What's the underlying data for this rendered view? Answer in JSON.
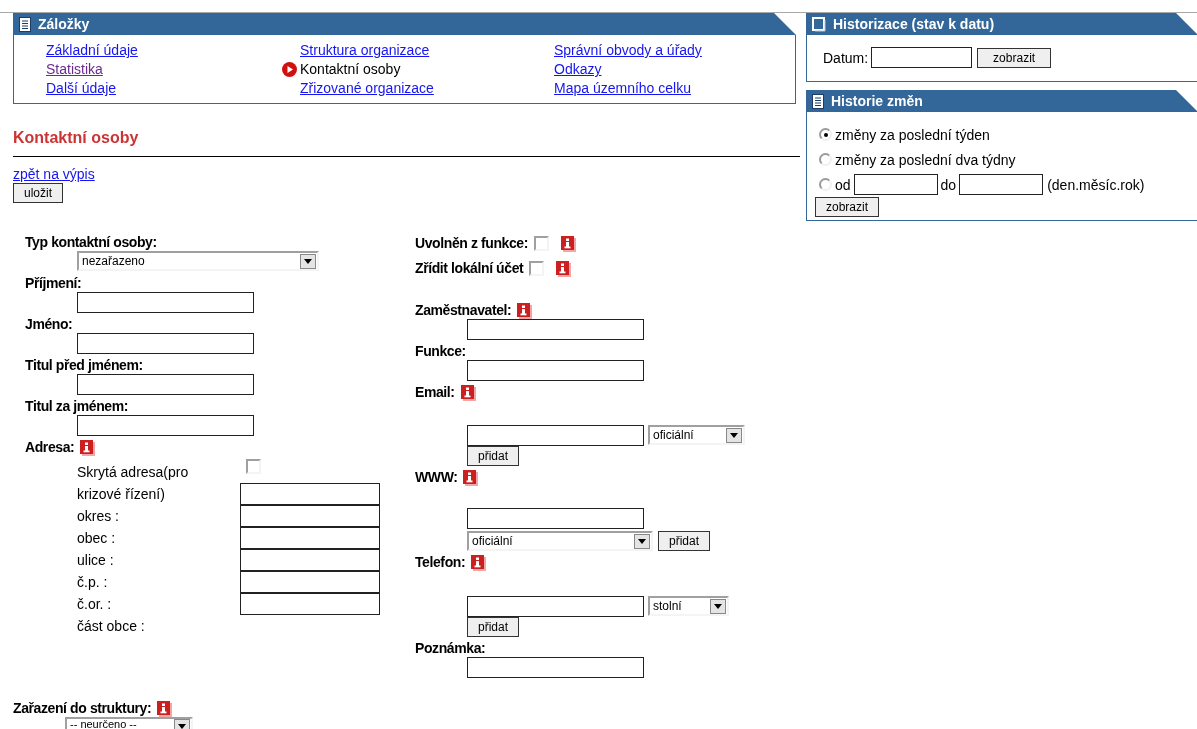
{
  "bookmarks": {
    "title": "Záložky",
    "links": [
      {
        "label": "Základní údaje",
        "selected": false,
        "visited": false
      },
      {
        "label": "Struktura organizace",
        "selected": false,
        "visited": false
      },
      {
        "label": "Správní obvody a úřady",
        "selected": false,
        "visited": false
      },
      {
        "label": "Statistika",
        "selected": false,
        "visited": true
      },
      {
        "label": "Kontaktní osoby",
        "selected": true,
        "visited": false
      },
      {
        "label": "Odkazy",
        "selected": false,
        "visited": false
      },
      {
        "label": "Další údaje",
        "selected": false,
        "visited": false
      },
      {
        "label": "Zřizované organizace",
        "selected": false,
        "visited": false
      },
      {
        "label": "Mapa územního celku",
        "selected": false,
        "visited": false
      }
    ]
  },
  "page_title": "Kontaktní osoby",
  "back_link": "zpět na výpis",
  "save_button": "uložit",
  "form": {
    "left": [
      {
        "kind": "select",
        "label": "Typ kontaktní osoby:",
        "info": false,
        "value": "nezařazeno"
      },
      {
        "kind": "text",
        "label": "Příjmení:",
        "info": false
      },
      {
        "kind": "text",
        "label": "Jméno:",
        "info": false
      },
      {
        "kind": "text",
        "label": "Titul před jménem:",
        "info": false
      },
      {
        "kind": "text",
        "label": "Titul za jménem:",
        "info": false
      },
      {
        "kind": "address",
        "label": "Adresa:",
        "info": true,
        "hidden_label": "Skrytá adresa(pro krizové řízení)",
        "hidden_checked": false,
        "hidden_field": true,
        "parts": [
          {
            "label": "okres :",
            "field": true
          },
          {
            "label": "obec :",
            "field": true
          },
          {
            "label": "ulice :",
            "field": true
          },
          {
            "label": "č.p. :",
            "field": true
          },
          {
            "label": "č.or. :",
            "field": true
          },
          {
            "label": "část obce :",
            "field": false
          }
        ]
      }
    ],
    "right": [
      {
        "kind": "checkbox",
        "label": "Uvolněn z funkce:",
        "checked": false,
        "info": true
      },
      {
        "kind": "checkbox",
        "label": "Zřídit lokální účet",
        "checked": false,
        "info": true
      },
      {
        "kind": "text",
        "label": "Zaměstnavatel:",
        "info": true
      },
      {
        "kind": "text",
        "label": "Funkce:",
        "info": false
      },
      {
        "kind": "multi",
        "label": "Email:",
        "info": true,
        "select_below": false,
        "type_value": "oficiální",
        "add_button": "přidat"
      },
      {
        "kind": "multi",
        "label": "WWW:",
        "info": true,
        "select_below": true,
        "type_value": "oficiální",
        "add_button": "přidat"
      },
      {
        "kind": "multi",
        "label": "Telefon:",
        "info": true,
        "select_below": false,
        "type_value": "stolní",
        "add_button": "přidat"
      },
      {
        "kind": "text",
        "label": "Poznámka:",
        "info": false
      }
    ],
    "structure": {
      "label": "Zařazení do struktury:",
      "info": true,
      "value": "-- neurčeno --"
    }
  },
  "historization": {
    "title": "Historizace (stav k datu)",
    "date_label": "Datum:",
    "button": "zobrazit"
  },
  "history": {
    "title": "Historie změn",
    "options": [
      {
        "kind": "plain",
        "label": "změny za poslední týden",
        "selected": true
      },
      {
        "kind": "plain",
        "label": "změny za poslední dva týdny",
        "selected": false
      },
      {
        "kind": "range",
        "label": "od",
        "to_label": "do",
        "hint": "(den.měsíc.rok)",
        "selected": false
      }
    ],
    "button": "zobrazit"
  }
}
